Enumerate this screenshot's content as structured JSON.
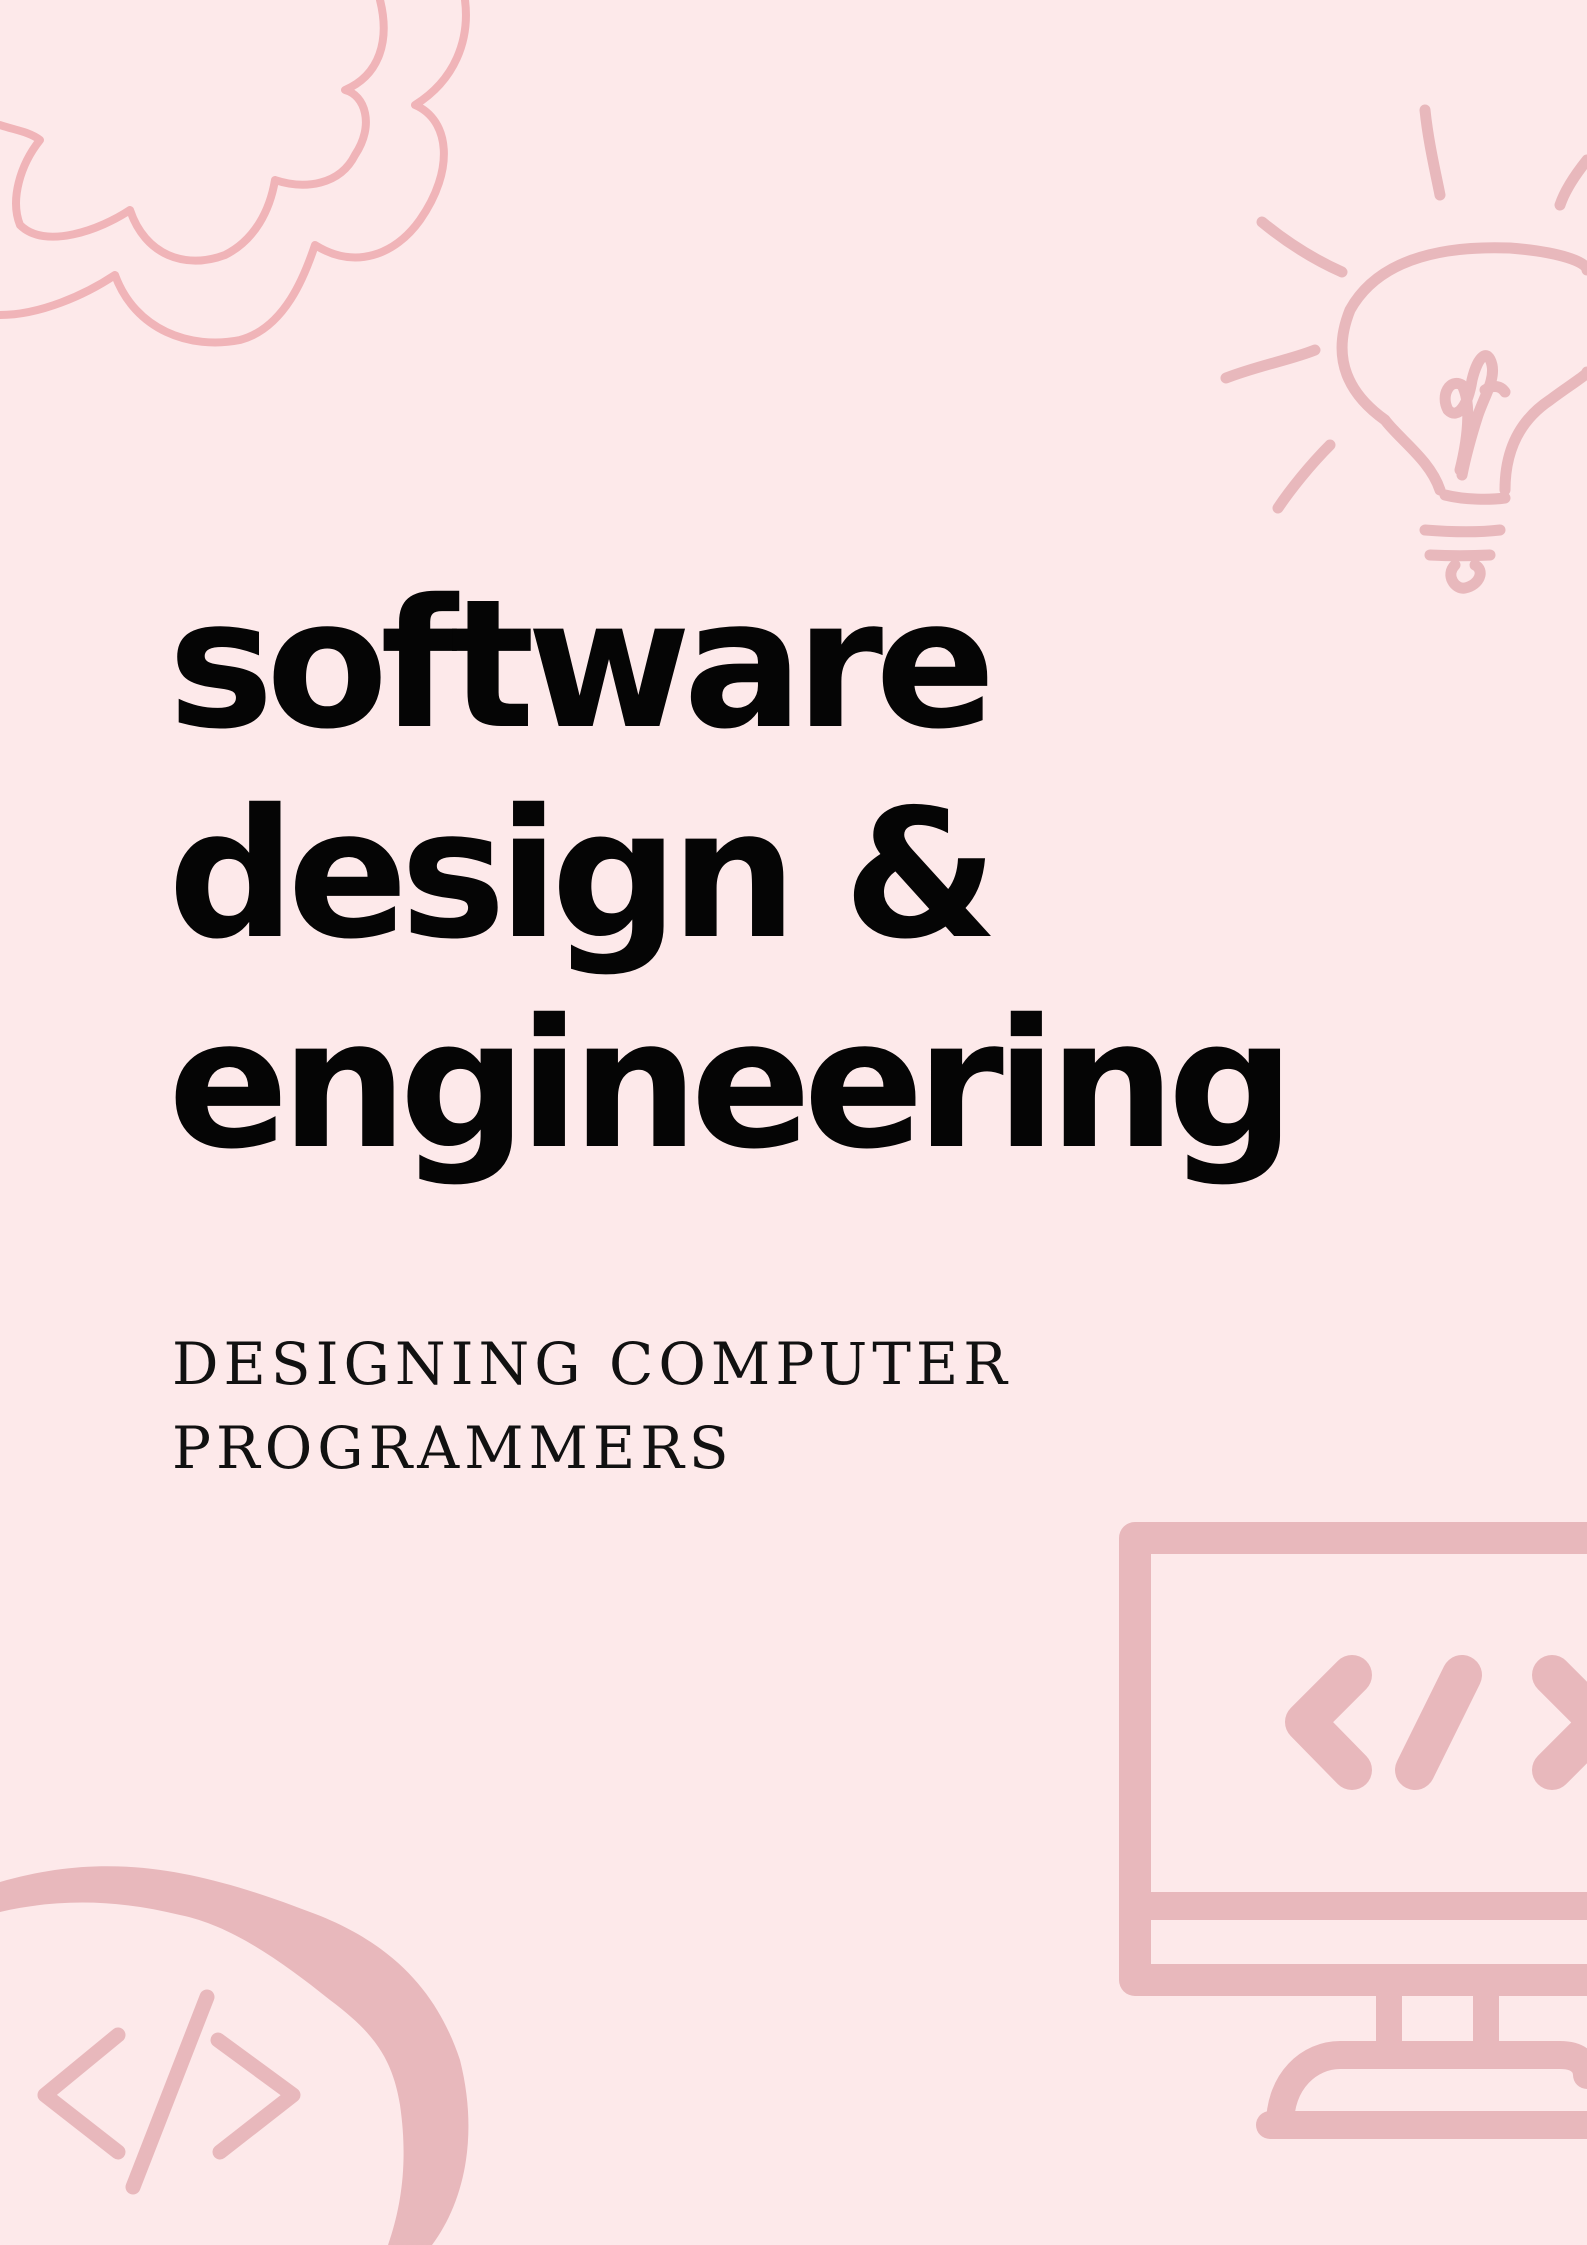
{
  "cover": {
    "title_lines": [
      "software",
      "design &",
      "engineering"
    ],
    "subtitle_lines": [
      "DESIGNING COMPUTER",
      "PROGRAMMERS"
    ],
    "background_color": "#fde9ea",
    "decoration_color": "#e8b8bc",
    "text_color": "#050505"
  },
  "decorations": [
    "cloud-icon",
    "lightbulb-icon",
    "monitor-code-icon",
    "code-tag-icon",
    "blob-shape"
  ]
}
